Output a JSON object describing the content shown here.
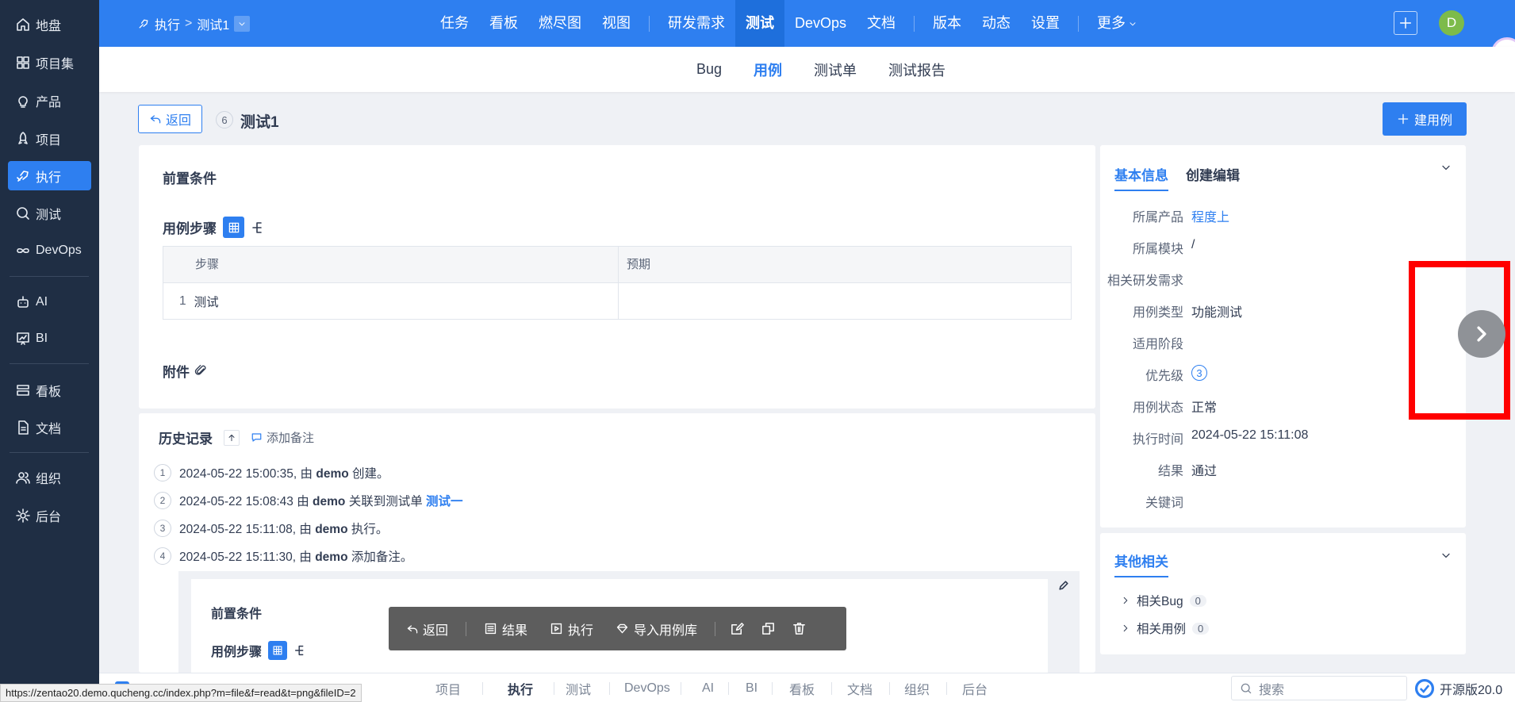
{
  "sidebar": {
    "items": [
      {
        "label": "地盘",
        "icon": "home-icon"
      },
      {
        "label": "项目集",
        "icon": "grid-icon"
      },
      {
        "label": "产品",
        "icon": "bulb-icon"
      },
      {
        "label": "项目",
        "icon": "rocket-icon"
      },
      {
        "label": "执行",
        "icon": "run-icon",
        "active": true
      },
      {
        "label": "测试",
        "icon": "search-check-icon"
      },
      {
        "label": "DevOps",
        "icon": "infinity-icon"
      },
      {
        "label": "AI",
        "icon": "robot-icon"
      },
      {
        "label": "BI",
        "icon": "chart-board-icon"
      },
      {
        "label": "看板",
        "icon": "kanban-icon"
      },
      {
        "label": "文档",
        "icon": "doc-icon"
      },
      {
        "label": "组织",
        "icon": "people-icon"
      },
      {
        "label": "后台",
        "icon": "gear-icon"
      }
    ]
  },
  "header": {
    "breadcrumb_root": "执行",
    "breadcrumb_current": "测试1",
    "nav": [
      "任务",
      "看板",
      "燃尽图",
      "视图",
      "研发需求",
      "测试",
      "DevOps",
      "文档",
      "版本",
      "动态",
      "设置",
      "更多"
    ],
    "active_nav": "测试",
    "avatar_letter": "D"
  },
  "subnav": {
    "tabs": [
      "Bug",
      "用例",
      "测试单",
      "测试报告"
    ],
    "active": "用例"
  },
  "page": {
    "back_label": "返回",
    "case_id": "6",
    "case_title": "测试1",
    "create_button": "建用例"
  },
  "main": {
    "precondition_title": "前置条件",
    "steps_title": "用例步骤",
    "steps_header_step": "步骤",
    "steps_header_expect": "预期",
    "steps": [
      {
        "no": "1",
        "step": "测试",
        "expect": ""
      }
    ],
    "attachments_title": "附件"
  },
  "history": {
    "title": "历史记录",
    "add_note": "添加备注",
    "entries": [
      {
        "no": "1",
        "text_pre": "2024-05-22 15:00:35, 由 ",
        "actor": "demo",
        "text_post": " 创建。",
        "link": ""
      },
      {
        "no": "2",
        "text_pre": "2024-05-22 15:08:43 由 ",
        "actor": "demo",
        "text_post": " 关联到测试单 ",
        "link": "测试一"
      },
      {
        "no": "3",
        "text_pre": "2024-05-22 15:11:08, 由 ",
        "actor": "demo",
        "text_post": " 执行。",
        "link": ""
      },
      {
        "no": "4",
        "text_pre": "2024-05-22 15:11:30, 由 ",
        "actor": "demo",
        "text_post": " 添加备注。",
        "link": ""
      }
    ],
    "inner_precondition": "前置条件",
    "inner_steps": "用例步骤"
  },
  "floating_toolbar": {
    "back": "返回",
    "result": "结果",
    "run": "执行",
    "import": "导入用例库"
  },
  "info": {
    "tab_basic": "基本信息",
    "tab_edit": "创建编辑",
    "fields": [
      {
        "k": "所属产品",
        "v": "程度上",
        "link": true
      },
      {
        "k": "所属模块",
        "v": "/"
      },
      {
        "k": "相关研发需求",
        "v": ""
      },
      {
        "k": "用例类型",
        "v": "功能测试"
      },
      {
        "k": "适用阶段",
        "v": ""
      },
      {
        "k": "优先级",
        "v": "3",
        "badge": true
      },
      {
        "k": "用例状态",
        "v": "正常"
      },
      {
        "k": "执行时间",
        "v": "2024-05-22 15:11:08"
      },
      {
        "k": "结果",
        "v": "通过"
      },
      {
        "k": "关键词",
        "v": ""
      }
    ]
  },
  "related": {
    "title": "其他相关",
    "items": [
      {
        "label": "相关Bug",
        "count": "0"
      },
      {
        "label": "相关用例",
        "count": "0"
      }
    ]
  },
  "bottom": {
    "status_url": "https://zentao20.demo.qucheng.cc/index.php?m=file&f=read&t=png&fileID=2",
    "items": [
      "项目",
      "执行",
      "测试",
      "DevOps",
      "AI",
      "BI",
      "看板",
      "文档",
      "组织",
      "后台"
    ],
    "active": "执行",
    "search_placeholder": "搜索",
    "version": "开源版20.0"
  },
  "colors": {
    "primary": "#2e7ff0",
    "sidebar": "#1f2e44",
    "highlight_box": "#ff0000"
  }
}
